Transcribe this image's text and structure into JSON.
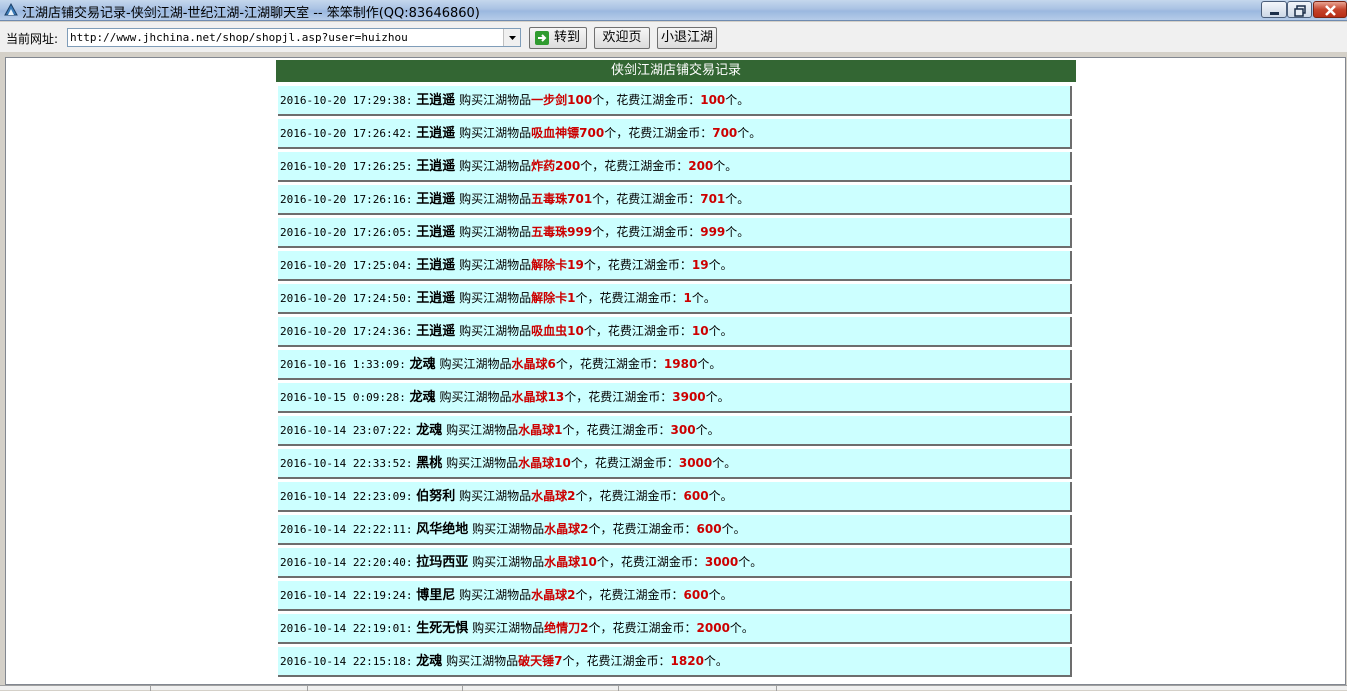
{
  "window": {
    "title": "江湖店铺交易记录-侠剑江湖-世纪江湖-江湖聊天室 -- 笨笨制作(QQ:83646860)"
  },
  "toolbar": {
    "address_label": "当前网址:",
    "url_value": "http://www.jhchina.net/shop/shopjl.asp?user=huizhou",
    "go_label": "转到",
    "home_label": "欢迎页",
    "exit_label": "小退江湖"
  },
  "page": {
    "header": "侠剑江湖店铺交易记录",
    "buy_text": "购买江湖物品",
    "cost_text": "个，花费江湖金币：",
    "unit_text": "个。"
  },
  "records": [
    {
      "time": "2016-10-20 17:29:38:",
      "user": "王逍遥",
      "item": "一步剑100",
      "cost": "100"
    },
    {
      "time": "2016-10-20 17:26:42:",
      "user": "王逍遥",
      "item": "吸血神镖700",
      "cost": "700"
    },
    {
      "time": "2016-10-20 17:26:25:",
      "user": "王逍遥",
      "item": "炸药200",
      "cost": "200"
    },
    {
      "time": "2016-10-20 17:26:16:",
      "user": "王逍遥",
      "item": "五毒珠701",
      "cost": "701"
    },
    {
      "time": "2016-10-20 17:26:05:",
      "user": "王逍遥",
      "item": "五毒珠999",
      "cost": "999"
    },
    {
      "time": "2016-10-20 17:25:04:",
      "user": "王逍遥",
      "item": "解除卡19",
      "cost": "19"
    },
    {
      "time": "2016-10-20 17:24:50:",
      "user": "王逍遥",
      "item": "解除卡1",
      "cost": "1"
    },
    {
      "time": "2016-10-20 17:24:36:",
      "user": "王逍遥",
      "item": "吸血虫10",
      "cost": "10"
    },
    {
      "time": "2016-10-16 1:33:09:",
      "user": "龙魂",
      "item": "水晶球6",
      "cost": "1980"
    },
    {
      "time": "2016-10-15 0:09:28:",
      "user": "龙魂",
      "item": "水晶球13",
      "cost": "3900"
    },
    {
      "time": "2016-10-14 23:07:22:",
      "user": "龙魂",
      "item": "水晶球1",
      "cost": "300"
    },
    {
      "time": "2016-10-14 22:33:52:",
      "user": "黑桃",
      "item": "水晶球10",
      "cost": "3000"
    },
    {
      "time": "2016-10-14 22:23:09:",
      "user": "伯努利",
      "item": "水晶球2",
      "cost": "600"
    },
    {
      "time": "2016-10-14 22:22:11:",
      "user": "风华绝地",
      "item": "水晶球2",
      "cost": "600"
    },
    {
      "time": "2016-10-14 22:20:40:",
      "user": "拉玛西亚",
      "item": "水晶球10",
      "cost": "3000"
    },
    {
      "time": "2016-10-14 22:19:24:",
      "user": "博里尼",
      "item": "水晶球2",
      "cost": "600"
    },
    {
      "time": "2016-10-14 22:19:01:",
      "user": "生死无惧",
      "item": "绝情刀2",
      "cost": "2000"
    },
    {
      "time": "2016-10-14 22:15:18:",
      "user": "龙魂",
      "item": "破天锤7",
      "cost": "1820"
    }
  ],
  "colors": {
    "header_bg": "#336633",
    "row_bg": "#ccffff",
    "highlight": "#cc0000"
  }
}
